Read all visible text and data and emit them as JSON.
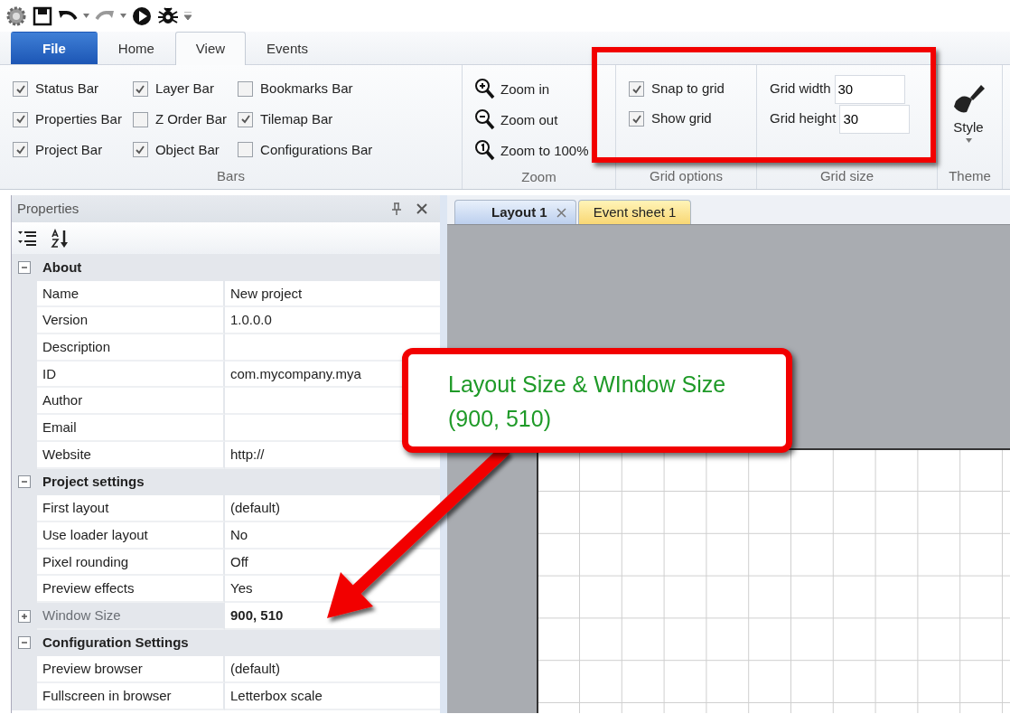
{
  "ribbon_tabs": [
    {
      "label": "File",
      "kind": "file",
      "selected": false
    },
    {
      "label": "Home",
      "kind": "tab",
      "selected": false
    },
    {
      "label": "View",
      "kind": "tab",
      "selected": true
    },
    {
      "label": "Events",
      "kind": "tab",
      "selected": false
    }
  ],
  "ribbon_groups": [
    {
      "label": "Bars",
      "kind": "checkgrid",
      "items": [
        {
          "label": "Status Bar",
          "checked": true
        },
        {
          "label": "Layer Bar",
          "checked": true
        },
        {
          "label": "Bookmarks Bar",
          "checked": false
        },
        {
          "label": "Properties Bar",
          "checked": true
        },
        {
          "label": "Z Order Bar",
          "checked": false
        },
        {
          "label": "Tilemap Bar",
          "checked": true
        },
        {
          "label": "Project Bar",
          "checked": true
        },
        {
          "label": "Object Bar",
          "checked": true
        },
        {
          "label": "Configurations Bar",
          "checked": false
        }
      ]
    },
    {
      "label": "Zoom",
      "kind": "buttons",
      "items": [
        {
          "label": "Zoom in"
        },
        {
          "label": "Zoom out"
        },
        {
          "label": "Zoom to 100%"
        }
      ]
    },
    {
      "label": "Grid options",
      "kind": "checklist",
      "items": [
        {
          "label": "Snap to grid",
          "checked": true
        },
        {
          "label": "Show grid",
          "checked": true
        }
      ]
    },
    {
      "label": "Grid size",
      "kind": "fields",
      "items": [
        {
          "label": "Grid width",
          "value": "30"
        },
        {
          "label": "Grid height",
          "value": "30"
        }
      ]
    },
    {
      "label": "Theme",
      "kind": "big",
      "items": [
        {
          "label": "Style"
        }
      ]
    }
  ],
  "properties_panel": {
    "title": "Properties",
    "categories": [
      {
        "name": "About",
        "expanded": true,
        "rows": [
          {
            "name": "Name",
            "value": "New project",
            "kind": "property",
            "modified": false
          },
          {
            "name": "Version",
            "value": "1.0.0.0",
            "kind": "property",
            "modified": false
          },
          {
            "name": "Description",
            "value": "",
            "kind": "property",
            "modified": false
          },
          {
            "name": "ID",
            "value": "com.mycompany.mya",
            "kind": "property",
            "modified": false
          },
          {
            "name": "Author",
            "value": "",
            "kind": "property",
            "modified": false
          },
          {
            "name": "Email",
            "value": "",
            "kind": "property",
            "modified": false
          },
          {
            "name": "Website",
            "value": "http://",
            "kind": "property",
            "modified": false
          }
        ]
      },
      {
        "name": "Project settings",
        "expanded": true,
        "rows": [
          {
            "name": "First layout",
            "value": "(default)",
            "kind": "property",
            "modified": false
          },
          {
            "name": "Use loader layout",
            "value": "No",
            "kind": "property",
            "modified": false
          },
          {
            "name": "Pixel rounding",
            "value": "Off",
            "kind": "property",
            "modified": false
          },
          {
            "name": "Preview effects",
            "value": "Yes",
            "kind": "property",
            "modified": false
          },
          {
            "name": "Window Size",
            "value": "900, 510",
            "kind": "group",
            "expanded": false,
            "modified": true
          }
        ]
      },
      {
        "name": "Configuration Settings",
        "expanded": true,
        "rows": [
          {
            "name": "Preview browser",
            "value": "(default)",
            "kind": "property",
            "modified": false
          },
          {
            "name": "Fullscreen in browser",
            "value": "Letterbox scale",
            "kind": "property",
            "modified": false
          }
        ]
      }
    ]
  },
  "editor": {
    "tabs": [
      {
        "label": "Layout 1",
        "kind": "layout",
        "selected": true,
        "closable": true
      },
      {
        "label": "Event sheet 1",
        "kind": "events",
        "selected": false,
        "closable": false
      }
    ]
  },
  "annotation": {
    "text": "Layout Size & WIndow Size\n(900, 510)"
  }
}
